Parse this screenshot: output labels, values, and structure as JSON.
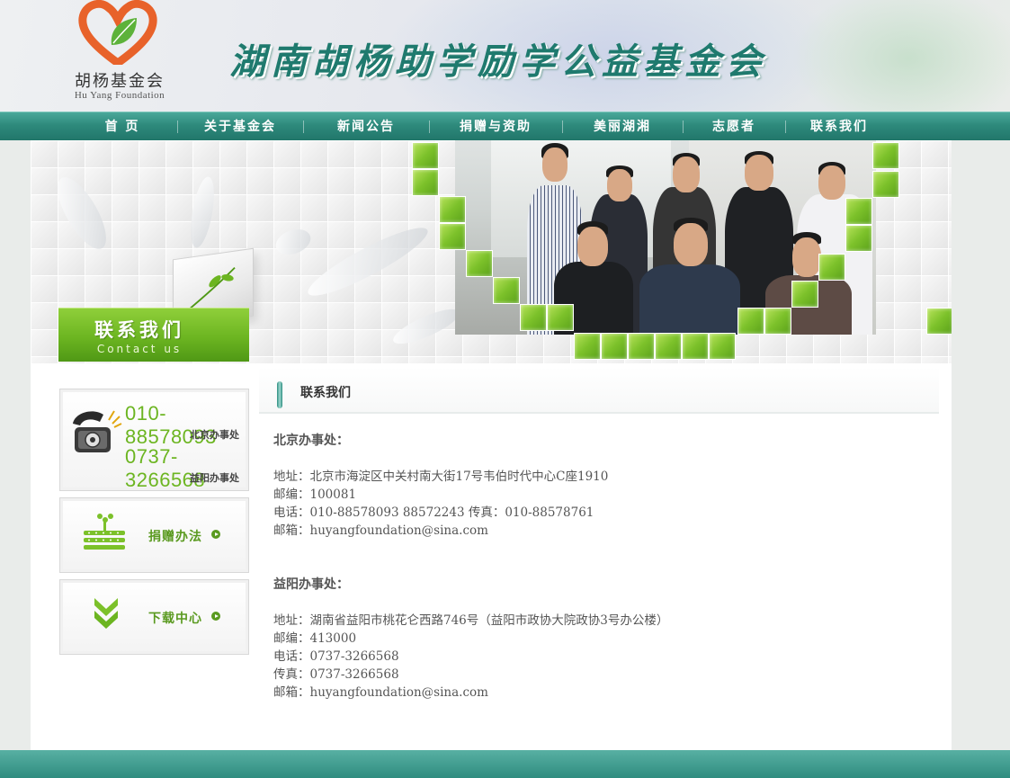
{
  "header": {
    "logo_cn": "胡杨基金会",
    "logo_en": "Hu Yang Foundation",
    "site_title": "湖南胡杨助学励学公益基金会"
  },
  "nav": {
    "items": [
      {
        "label": "首 页"
      },
      {
        "label": "关于基金会"
      },
      {
        "label": "新闻公告"
      },
      {
        "label": "捐赠与资助"
      },
      {
        "label": "美丽湖湘"
      },
      {
        "label": "志愿者"
      },
      {
        "label": "联系我们"
      }
    ]
  },
  "banner": {
    "section_cn": "联系我们",
    "section_en": "Contact us"
  },
  "sidebar": {
    "beijing_phone": "010-88578093",
    "beijing_label": "北京办事处",
    "yiyang_phone": "0737-3266568",
    "yiyang_label": "益阳办事处",
    "donate_label": "捐赠办法",
    "download_label": "下载中心"
  },
  "content": {
    "heading": "联系我们",
    "offices": [
      {
        "title": "北京办事处：",
        "lines": [
          "地址：北京市海淀区中关村南大街17号韦伯时代中心C座1910",
          "邮编：100081",
          "电话：010-88578093  88572243 传真：010-88578761",
          "邮箱：huyangfoundation@sina.com"
        ]
      },
      {
        "title": "益阳办事处：",
        "lines": [
          "地址：湖南省益阳市桃花仑西路746号（益阳市政协大院政协3号办公楼）",
          "邮编：413000",
          "电话：0737-3266568",
          "传真：0737-3266568",
          "邮箱：huyangfoundation@sina.com"
        ]
      }
    ]
  },
  "colors": {
    "nav_teal": "#2e8a7c",
    "accent_green": "#6cb521",
    "title_teal": "#1f7a6e"
  }
}
